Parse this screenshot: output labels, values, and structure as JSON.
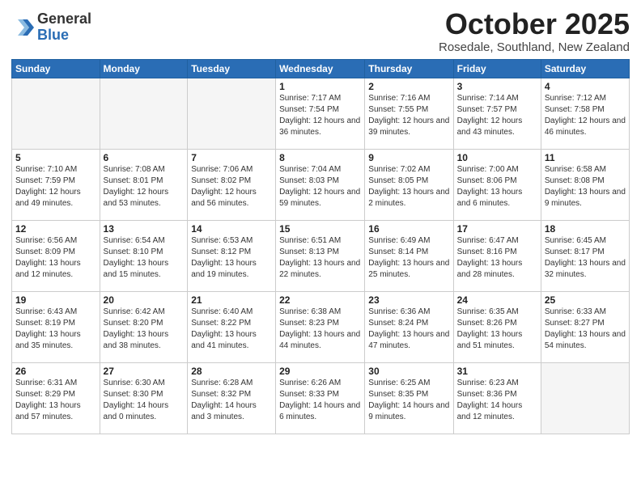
{
  "header": {
    "logo_general": "General",
    "logo_blue": "Blue",
    "month": "October 2025",
    "location": "Rosedale, Southland, New Zealand"
  },
  "weekdays": [
    "Sunday",
    "Monday",
    "Tuesday",
    "Wednesday",
    "Thursday",
    "Friday",
    "Saturday"
  ],
  "weeks": [
    [
      {
        "day": "",
        "info": ""
      },
      {
        "day": "",
        "info": ""
      },
      {
        "day": "",
        "info": ""
      },
      {
        "day": "1",
        "info": "Sunrise: 7:17 AM\nSunset: 7:54 PM\nDaylight: 12 hours\nand 36 minutes."
      },
      {
        "day": "2",
        "info": "Sunrise: 7:16 AM\nSunset: 7:55 PM\nDaylight: 12 hours\nand 39 minutes."
      },
      {
        "day": "3",
        "info": "Sunrise: 7:14 AM\nSunset: 7:57 PM\nDaylight: 12 hours\nand 43 minutes."
      },
      {
        "day": "4",
        "info": "Sunrise: 7:12 AM\nSunset: 7:58 PM\nDaylight: 12 hours\nand 46 minutes."
      }
    ],
    [
      {
        "day": "5",
        "info": "Sunrise: 7:10 AM\nSunset: 7:59 PM\nDaylight: 12 hours\nand 49 minutes."
      },
      {
        "day": "6",
        "info": "Sunrise: 7:08 AM\nSunset: 8:01 PM\nDaylight: 12 hours\nand 53 minutes."
      },
      {
        "day": "7",
        "info": "Sunrise: 7:06 AM\nSunset: 8:02 PM\nDaylight: 12 hours\nand 56 minutes."
      },
      {
        "day": "8",
        "info": "Sunrise: 7:04 AM\nSunset: 8:03 PM\nDaylight: 12 hours\nand 59 minutes."
      },
      {
        "day": "9",
        "info": "Sunrise: 7:02 AM\nSunset: 8:05 PM\nDaylight: 13 hours\nand 2 minutes."
      },
      {
        "day": "10",
        "info": "Sunrise: 7:00 AM\nSunset: 8:06 PM\nDaylight: 13 hours\nand 6 minutes."
      },
      {
        "day": "11",
        "info": "Sunrise: 6:58 AM\nSunset: 8:08 PM\nDaylight: 13 hours\nand 9 minutes."
      }
    ],
    [
      {
        "day": "12",
        "info": "Sunrise: 6:56 AM\nSunset: 8:09 PM\nDaylight: 13 hours\nand 12 minutes."
      },
      {
        "day": "13",
        "info": "Sunrise: 6:54 AM\nSunset: 8:10 PM\nDaylight: 13 hours\nand 15 minutes."
      },
      {
        "day": "14",
        "info": "Sunrise: 6:53 AM\nSunset: 8:12 PM\nDaylight: 13 hours\nand 19 minutes."
      },
      {
        "day": "15",
        "info": "Sunrise: 6:51 AM\nSunset: 8:13 PM\nDaylight: 13 hours\nand 22 minutes."
      },
      {
        "day": "16",
        "info": "Sunrise: 6:49 AM\nSunset: 8:14 PM\nDaylight: 13 hours\nand 25 minutes."
      },
      {
        "day": "17",
        "info": "Sunrise: 6:47 AM\nSunset: 8:16 PM\nDaylight: 13 hours\nand 28 minutes."
      },
      {
        "day": "18",
        "info": "Sunrise: 6:45 AM\nSunset: 8:17 PM\nDaylight: 13 hours\nand 32 minutes."
      }
    ],
    [
      {
        "day": "19",
        "info": "Sunrise: 6:43 AM\nSunset: 8:19 PM\nDaylight: 13 hours\nand 35 minutes."
      },
      {
        "day": "20",
        "info": "Sunrise: 6:42 AM\nSunset: 8:20 PM\nDaylight: 13 hours\nand 38 minutes."
      },
      {
        "day": "21",
        "info": "Sunrise: 6:40 AM\nSunset: 8:22 PM\nDaylight: 13 hours\nand 41 minutes."
      },
      {
        "day": "22",
        "info": "Sunrise: 6:38 AM\nSunset: 8:23 PM\nDaylight: 13 hours\nand 44 minutes."
      },
      {
        "day": "23",
        "info": "Sunrise: 6:36 AM\nSunset: 8:24 PM\nDaylight: 13 hours\nand 47 minutes."
      },
      {
        "day": "24",
        "info": "Sunrise: 6:35 AM\nSunset: 8:26 PM\nDaylight: 13 hours\nand 51 minutes."
      },
      {
        "day": "25",
        "info": "Sunrise: 6:33 AM\nSunset: 8:27 PM\nDaylight: 13 hours\nand 54 minutes."
      }
    ],
    [
      {
        "day": "26",
        "info": "Sunrise: 6:31 AM\nSunset: 8:29 PM\nDaylight: 13 hours\nand 57 minutes."
      },
      {
        "day": "27",
        "info": "Sunrise: 6:30 AM\nSunset: 8:30 PM\nDaylight: 14 hours\nand 0 minutes."
      },
      {
        "day": "28",
        "info": "Sunrise: 6:28 AM\nSunset: 8:32 PM\nDaylight: 14 hours\nand 3 minutes."
      },
      {
        "day": "29",
        "info": "Sunrise: 6:26 AM\nSunset: 8:33 PM\nDaylight: 14 hours\nand 6 minutes."
      },
      {
        "day": "30",
        "info": "Sunrise: 6:25 AM\nSunset: 8:35 PM\nDaylight: 14 hours\nand 9 minutes."
      },
      {
        "day": "31",
        "info": "Sunrise: 6:23 AM\nSunset: 8:36 PM\nDaylight: 14 hours\nand 12 minutes."
      },
      {
        "day": "",
        "info": ""
      }
    ]
  ]
}
